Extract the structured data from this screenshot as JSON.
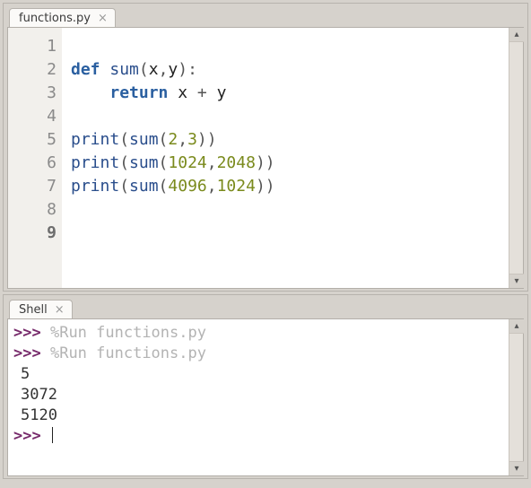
{
  "editor": {
    "tab_label": "functions.py",
    "line_numbers": [
      "1",
      "2",
      "3",
      "4",
      "5",
      "6",
      "7",
      "8",
      "9"
    ],
    "current_line_index": 8,
    "code": {
      "l1": "",
      "l2": {
        "kw": "def",
        "name": "sum",
        "open": "(",
        "args": [
          "x",
          "y"
        ],
        "comma": ",",
        "close": "):"
      },
      "l3": {
        "kw": "return",
        "expr_left": "x",
        "op": "+",
        "expr_right": "y",
        "indent": "    "
      },
      "l4": "",
      "l5": {
        "fn": "print",
        "open": "(",
        "call": "sum",
        "open2": "(",
        "a": "2",
        "comma": ",",
        "b": "3",
        "close2": ")",
        "close": ")"
      },
      "l6": {
        "fn": "print",
        "open": "(",
        "call": "sum",
        "open2": "(",
        "a": "1024",
        "comma": ",",
        "b": "2048",
        "close2": ")",
        "close": ")"
      },
      "l7": {
        "fn": "print",
        "open": "(",
        "call": "sum",
        "open2": "(",
        "a": "4096",
        "comma": ",",
        "b": "1024",
        "close2": ")",
        "close": ")"
      },
      "l8": "",
      "l9": ""
    }
  },
  "shell": {
    "tab_label": "Shell",
    "prompt": ">>>",
    "run_cmd": "%Run functions.py",
    "outputs": [
      "5",
      "3072",
      "5120"
    ]
  }
}
